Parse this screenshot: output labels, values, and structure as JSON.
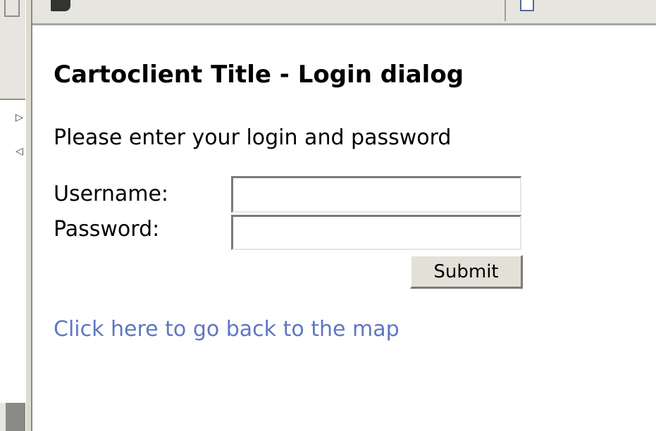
{
  "page": {
    "title": "Cartoclient Title - Login dialog",
    "instruction": "Please enter your login and password"
  },
  "form": {
    "username_label": "Username:",
    "username_value": "",
    "password_label": "Password:",
    "password_value": "",
    "submit_label": "Submit"
  },
  "links": {
    "back_to_map": "Click here to go back to the map"
  },
  "icons": {
    "toolbar_left": "toolbar-app-icon",
    "toolbar_right": "document-icon",
    "sidebar_expand": "triangle-right-icon",
    "sidebar_collapse": "triangle-left-icon"
  },
  "colors": {
    "link": "#5f77c0",
    "chrome": "#e6e5df",
    "text": "#000000"
  }
}
